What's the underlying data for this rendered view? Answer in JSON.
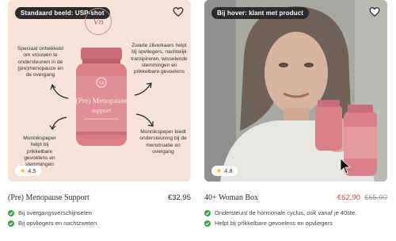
{
  "products": [
    {
      "image_label": "Standaard beeld: USP-shot",
      "rating": "4.5",
      "logo_text": "Vn",
      "usp_top_left": [
        "Speciaal ontwikkeld",
        "om vrouwen te",
        "ondersteunen in de",
        "(pre)menopauze en",
        "de overgang"
      ],
      "usp_top_right": [
        "Zwarte zilverkaars helpt",
        "bij opvliegers, nachtelijk",
        "transpireren, wisselende",
        "stemmingen en",
        "prikkelbare gevoelens"
      ],
      "usp_bottom_left": [
        "Monnikspeper",
        "helpt bij",
        "prikkelbare",
        "gevoelens en",
        "stemmingen"
      ],
      "usp_bottom_right": [
        "Monnikspeper biedt",
        "ondersteuning bij de",
        "menstruatie en",
        "overgang"
      ],
      "bottle_label_title": "(Pre) Menopause",
      "bottle_label_sub": "support",
      "name": "(Pre) Menopause Support",
      "price": "€32,95",
      "features": [
        "Bij overgangsverschijnselen",
        "Bij opvliegers en nachtzweten"
      ]
    },
    {
      "image_label": "Bij hover: klant met product",
      "rating": "4.8",
      "name": "40+ Woman Box",
      "price_sale": "€62,90",
      "price_old": "€65,90",
      "features": [
        "Ondersteunt de hormonale cyclus, ook vanaf je 40ste.",
        "Helpt bij prikkelbare gevoelens en opvliegers"
      ]
    }
  ],
  "colors": {
    "accent_green": "#3aa34a",
    "sale_red": "#c64b4b",
    "bottle_pink": "#d97f86",
    "label_dark": "#2d2a2a"
  },
  "icons": [
    "heart-icon",
    "star-icon",
    "check-icon",
    "arrow-icon",
    "cursor-icon"
  ]
}
